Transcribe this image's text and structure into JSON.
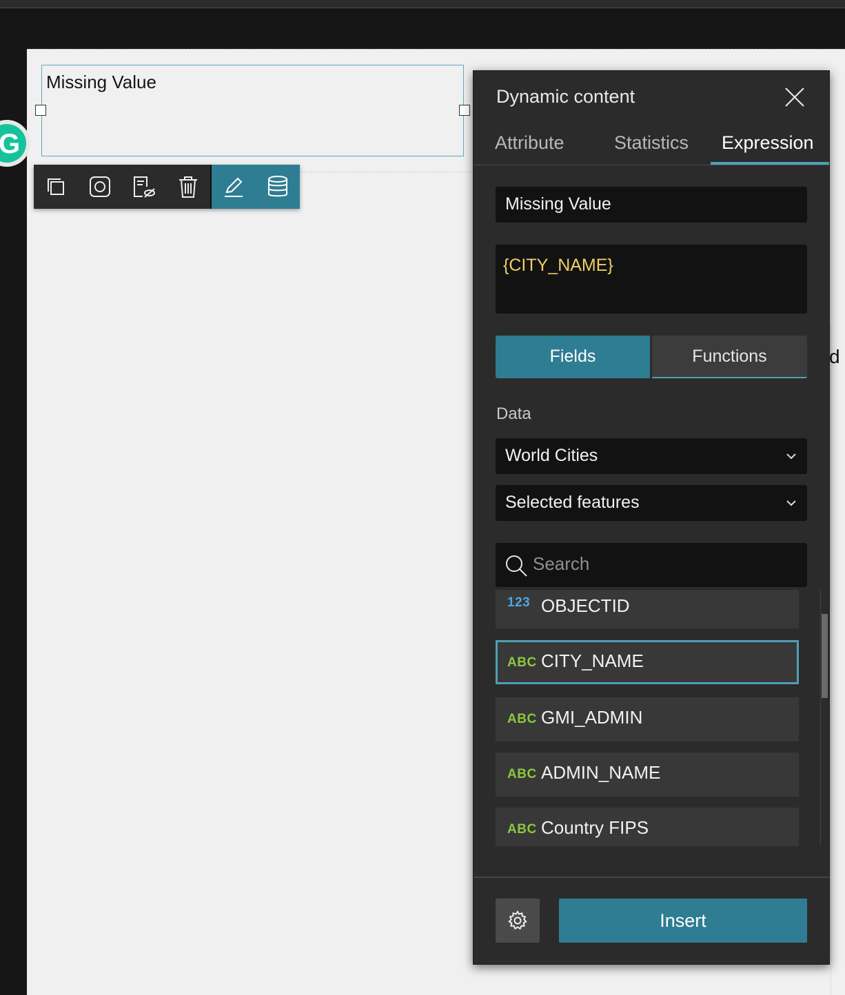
{
  "canvas": {
    "textbox_text": "Missing Value",
    "right_edge_text": "d"
  },
  "toolbar": {
    "icons": [
      "duplicate-icon",
      "screenshot-icon",
      "edit-off-icon",
      "delete-icon",
      "pen-icon",
      "database-icon"
    ]
  },
  "panel": {
    "title": "Dynamic content",
    "tabs": [
      {
        "label": "Attribute",
        "active": false
      },
      {
        "label": "Statistics",
        "active": false
      },
      {
        "label": "Expression",
        "active": true
      }
    ],
    "title_input_value": "Missing Value",
    "expression_value": "{CITY_NAME}",
    "segmented": {
      "fields": "Fields",
      "functions": "Functions"
    },
    "data_label": "Data",
    "data_source": "World Cities",
    "selection_mode": "Selected features",
    "search_placeholder": "Search",
    "fields": [
      {
        "type": "123",
        "name": "OBJECTID"
      },
      {
        "type": "ABC",
        "name": "CITY_NAME"
      },
      {
        "type": "ABC",
        "name": "GMI_ADMIN"
      },
      {
        "type": "ABC",
        "name": "ADMIN_NAME"
      },
      {
        "type": "ABC",
        "name": "Country FIPS"
      }
    ],
    "insert_label": "Insert"
  },
  "colors": {
    "accent": "#2f7d93",
    "expression_text": "#f1cf63",
    "number_type": "#4da8de",
    "string_type": "#8cc83e"
  }
}
